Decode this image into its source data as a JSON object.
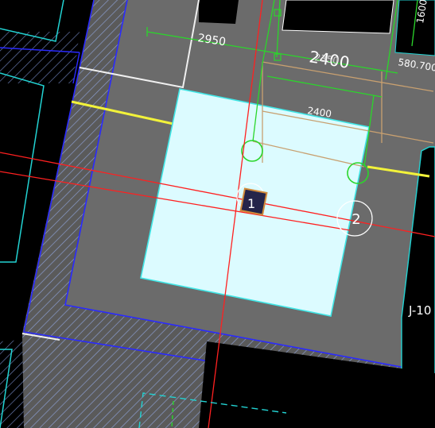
{
  "drawing": {
    "dimensions": {
      "top_overall": "2950",
      "top_bay_large": "2400",
      "top_bay_small": "2350",
      "inner_span": "2400",
      "side_small": "580.700",
      "vertical_right": "1600"
    },
    "labels": {
      "footing_tag": "J-10",
      "grid_bubble_right": "2",
      "grid_bubble_center": "1"
    },
    "colors": {
      "background": "#000000",
      "slab_gray": "#6b6b6b",
      "hatch": "#7a8fc0",
      "footing_fill": "#dcfbff",
      "footing_edge": "#3fe6e6",
      "grid_red": "#ff2020",
      "dim_green": "#2bd62b",
      "beam_yellow": "#f2f23a",
      "outline_blue": "#2a2aff",
      "outline_cyan": "#22d3d3",
      "column_fill": "#25254a",
      "brace_tan": "#c8a070",
      "text_white": "#ffffff"
    }
  }
}
